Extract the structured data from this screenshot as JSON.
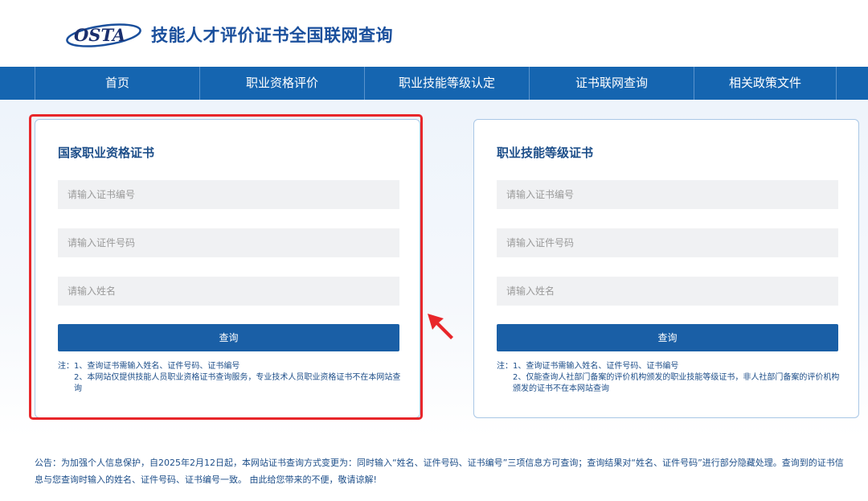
{
  "header": {
    "logo_text": "OSTA",
    "title": "技能人才评价证书全国联网查询"
  },
  "nav": {
    "items": [
      "首页",
      "职业资格评价",
      "职业技能等级认定",
      "证书联网查询",
      "相关政策文件"
    ]
  },
  "cards": [
    {
      "title": "国家职业资格证书",
      "placeholders": [
        "请输入证书编号",
        "请输入证件号码",
        "请输入姓名"
      ],
      "button": "查询",
      "notes": {
        "prefix": "注：",
        "line1": "1、查询证书需输入姓名、证件号码、证书编号",
        "line2": "2、本网站仅提供技能人员职业资格证书查询服务，专业技术人员职业资格证书不在本网站查询"
      }
    },
    {
      "title": "职业技能等级证书",
      "placeholders": [
        "请输入证书编号",
        "请输入证件号码",
        "请输入姓名"
      ],
      "button": "查询",
      "notes": {
        "prefix": "注：",
        "line1": "1、查询证书需输入姓名、证件号码、证书编号",
        "line2": "2、仅能查询人社部门备案的评价机构颁发的职业技能等级证书，非人社部门备案的评价机构颁发的证书不在本网站查询"
      }
    }
  ],
  "notice": "公告：为加强个人信息保护，自2025年2月12日起，本网站证书查询方式变更为：同时输入“姓名、证件号码、证书编号”三项信息方可查询；查询结果对“姓名、证件号码”进行部分隐藏处理。查询到的证书信息与您查询时输入的姓名、证件号码、证书编号一致。 由此给您带来的不便，敬请谅解!",
  "colors": {
    "nav_bg": "#1565b0",
    "button_bg": "#1a5fa6",
    "title_blue": "#1a4f9c",
    "highlight_red": "#e8262a"
  }
}
